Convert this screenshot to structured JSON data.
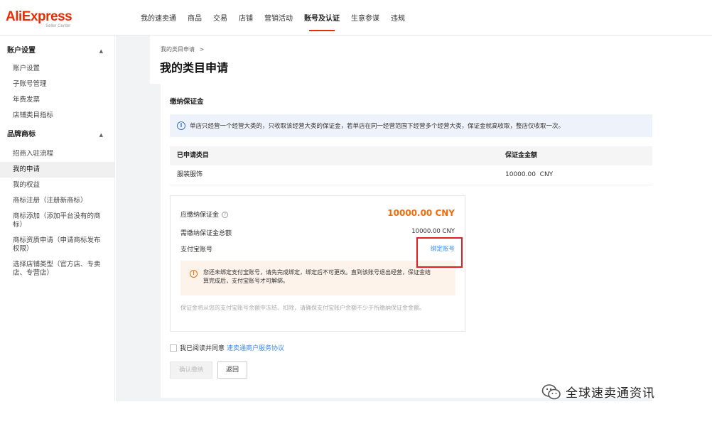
{
  "brand": {
    "logo_text": "AliExpress",
    "logo_sub": "Seller Center",
    "accent": "#e62e04"
  },
  "nav": {
    "items": [
      "我的速卖通",
      "商品",
      "交易",
      "店铺",
      "营销活动",
      "账号及认证",
      "生意参谋",
      "违规"
    ],
    "active": "账号及认证"
  },
  "sidebar": {
    "group1": {
      "title": "账户设置",
      "items": [
        "账户设置",
        "子账号管理",
        "年费发票",
        "店铺类目指标"
      ]
    },
    "group2": {
      "title": "品牌商标",
      "items": [
        "招商入驻流程",
        "我的申请",
        "我的权益",
        "商标注册（注册新商标）",
        "商标添加（添加平台没有的商标）",
        "商标资质申请（申请商标发布权限）",
        "选择店铺类型（官方店、专卖店、专营店）"
      ],
      "active": "我的申请"
    }
  },
  "breadcrumb": {
    "label": "我的类目申请",
    "separator": ">"
  },
  "page_title": "我的类目申请",
  "section": {
    "title": "缴纳保证金",
    "info": "单店只经营一个经营大类的，只收取该经营大类的保证金，若单店在同一经营范围下经营多个经营大类，保证金就高收取，整店仅收取一次。"
  },
  "table": {
    "headers": [
      "已申请类目",
      "保证金金额"
    ],
    "rows": [
      {
        "category": "服装服饰",
        "amount": "10000.00  CNY"
      }
    ]
  },
  "payment": {
    "due_label": "应缴纳保证金",
    "due_amount": "10000.00 CNY",
    "total_label": "需缴纳保证金总额",
    "total_amount": "10000.00 CNY",
    "alipay_label": "支付宝账号",
    "bind_link": "绑定账号",
    "warning": "您还未绑定支付宝账号，请先完成绑定，绑定后不可更改。直到该账号退出经营，保证金结算完成后，支付宝账号才可解绑。",
    "note": "保证金将从您的支付宝账号余额中冻结、扣除，请确保支付宝账户余额不少于所缴纳保证金金额。"
  },
  "agreement": {
    "prefix": "我已阅读并同意",
    "link": "速卖通商户服务协议",
    "checked": false
  },
  "buttons": {
    "confirm": "确认缴纳",
    "back": "返回"
  },
  "watermark": {
    "text": "全球速卖通资讯"
  },
  "colors": {
    "amount": "#f26b0a",
    "link": "#3b8cf0",
    "highlight_box": "#e02020",
    "info_bg": "#eef3fb",
    "warning_bg": "#fdf3ea"
  }
}
